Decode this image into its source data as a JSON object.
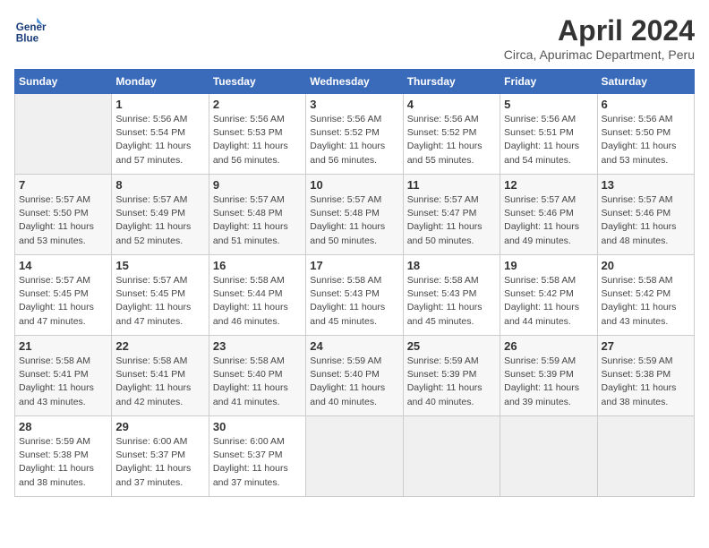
{
  "logo": {
    "line1": "General",
    "line2": "Blue"
  },
  "title": "April 2024",
  "subtitle": "Circa, Apurimac Department, Peru",
  "weekdays": [
    "Sunday",
    "Monday",
    "Tuesday",
    "Wednesday",
    "Thursday",
    "Friday",
    "Saturday"
  ],
  "weeks": [
    [
      {
        "day": "",
        "info": ""
      },
      {
        "day": "1",
        "info": "Sunrise: 5:56 AM\nSunset: 5:54 PM\nDaylight: 11 hours\nand 57 minutes."
      },
      {
        "day": "2",
        "info": "Sunrise: 5:56 AM\nSunset: 5:53 PM\nDaylight: 11 hours\nand 56 minutes."
      },
      {
        "day": "3",
        "info": "Sunrise: 5:56 AM\nSunset: 5:52 PM\nDaylight: 11 hours\nand 56 minutes."
      },
      {
        "day": "4",
        "info": "Sunrise: 5:56 AM\nSunset: 5:52 PM\nDaylight: 11 hours\nand 55 minutes."
      },
      {
        "day": "5",
        "info": "Sunrise: 5:56 AM\nSunset: 5:51 PM\nDaylight: 11 hours\nand 54 minutes."
      },
      {
        "day": "6",
        "info": "Sunrise: 5:56 AM\nSunset: 5:50 PM\nDaylight: 11 hours\nand 53 minutes."
      }
    ],
    [
      {
        "day": "7",
        "info": "Sunrise: 5:57 AM\nSunset: 5:50 PM\nDaylight: 11 hours\nand 53 minutes."
      },
      {
        "day": "8",
        "info": "Sunrise: 5:57 AM\nSunset: 5:49 PM\nDaylight: 11 hours\nand 52 minutes."
      },
      {
        "day": "9",
        "info": "Sunrise: 5:57 AM\nSunset: 5:48 PM\nDaylight: 11 hours\nand 51 minutes."
      },
      {
        "day": "10",
        "info": "Sunrise: 5:57 AM\nSunset: 5:48 PM\nDaylight: 11 hours\nand 50 minutes."
      },
      {
        "day": "11",
        "info": "Sunrise: 5:57 AM\nSunset: 5:47 PM\nDaylight: 11 hours\nand 50 minutes."
      },
      {
        "day": "12",
        "info": "Sunrise: 5:57 AM\nSunset: 5:46 PM\nDaylight: 11 hours\nand 49 minutes."
      },
      {
        "day": "13",
        "info": "Sunrise: 5:57 AM\nSunset: 5:46 PM\nDaylight: 11 hours\nand 48 minutes."
      }
    ],
    [
      {
        "day": "14",
        "info": "Sunrise: 5:57 AM\nSunset: 5:45 PM\nDaylight: 11 hours\nand 47 minutes."
      },
      {
        "day": "15",
        "info": "Sunrise: 5:57 AM\nSunset: 5:45 PM\nDaylight: 11 hours\nand 47 minutes."
      },
      {
        "day": "16",
        "info": "Sunrise: 5:58 AM\nSunset: 5:44 PM\nDaylight: 11 hours\nand 46 minutes."
      },
      {
        "day": "17",
        "info": "Sunrise: 5:58 AM\nSunset: 5:43 PM\nDaylight: 11 hours\nand 45 minutes."
      },
      {
        "day": "18",
        "info": "Sunrise: 5:58 AM\nSunset: 5:43 PM\nDaylight: 11 hours\nand 45 minutes."
      },
      {
        "day": "19",
        "info": "Sunrise: 5:58 AM\nSunset: 5:42 PM\nDaylight: 11 hours\nand 44 minutes."
      },
      {
        "day": "20",
        "info": "Sunrise: 5:58 AM\nSunset: 5:42 PM\nDaylight: 11 hours\nand 43 minutes."
      }
    ],
    [
      {
        "day": "21",
        "info": "Sunrise: 5:58 AM\nSunset: 5:41 PM\nDaylight: 11 hours\nand 43 minutes."
      },
      {
        "day": "22",
        "info": "Sunrise: 5:58 AM\nSunset: 5:41 PM\nDaylight: 11 hours\nand 42 minutes."
      },
      {
        "day": "23",
        "info": "Sunrise: 5:58 AM\nSunset: 5:40 PM\nDaylight: 11 hours\nand 41 minutes."
      },
      {
        "day": "24",
        "info": "Sunrise: 5:59 AM\nSunset: 5:40 PM\nDaylight: 11 hours\nand 40 minutes."
      },
      {
        "day": "25",
        "info": "Sunrise: 5:59 AM\nSunset: 5:39 PM\nDaylight: 11 hours\nand 40 minutes."
      },
      {
        "day": "26",
        "info": "Sunrise: 5:59 AM\nSunset: 5:39 PM\nDaylight: 11 hours\nand 39 minutes."
      },
      {
        "day": "27",
        "info": "Sunrise: 5:59 AM\nSunset: 5:38 PM\nDaylight: 11 hours\nand 38 minutes."
      }
    ],
    [
      {
        "day": "28",
        "info": "Sunrise: 5:59 AM\nSunset: 5:38 PM\nDaylight: 11 hours\nand 38 minutes."
      },
      {
        "day": "29",
        "info": "Sunrise: 6:00 AM\nSunset: 5:37 PM\nDaylight: 11 hours\nand 37 minutes."
      },
      {
        "day": "30",
        "info": "Sunrise: 6:00 AM\nSunset: 5:37 PM\nDaylight: 11 hours\nand 37 minutes."
      },
      {
        "day": "",
        "info": ""
      },
      {
        "day": "",
        "info": ""
      },
      {
        "day": "",
        "info": ""
      },
      {
        "day": "",
        "info": ""
      }
    ]
  ]
}
